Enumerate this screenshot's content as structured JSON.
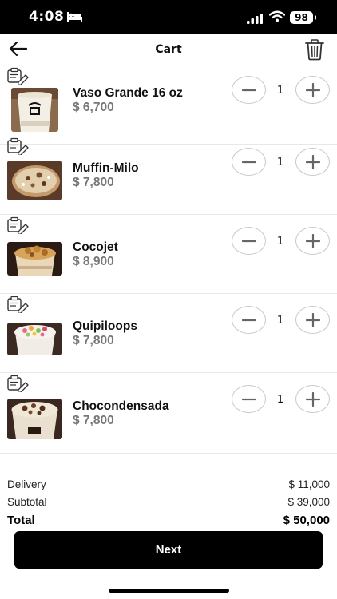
{
  "status_bar": {
    "time": "4:08",
    "battery": "98"
  },
  "header": {
    "title": "Cart"
  },
  "items": [
    {
      "name": "Vaso Grande 16 oz",
      "price": "$ 6,700",
      "quantity": "1"
    },
    {
      "name": "Muffin-Milo",
      "price": "$ 7,800",
      "quantity": "1"
    },
    {
      "name": "Cocojet",
      "price": "$ 8,900",
      "quantity": "1"
    },
    {
      "name": "Quipiloops",
      "price": "$ 7,800",
      "quantity": "1"
    },
    {
      "name": "Chocondensada",
      "price": "$ 7,800",
      "quantity": "1"
    }
  ],
  "summary": {
    "delivery_label": "Delivery",
    "delivery_value": "$ 11,000",
    "subtotal_label": "Subtotal",
    "subtotal_value": "$ 39,000",
    "total_label": "Total",
    "total_value": "$ 50,000"
  },
  "next_label": "Next",
  "icons": {
    "back": "arrow-left-icon",
    "trash": "trash-icon",
    "note": "note-edit-icon",
    "minus": "minus-icon",
    "plus": "plus-icon"
  }
}
